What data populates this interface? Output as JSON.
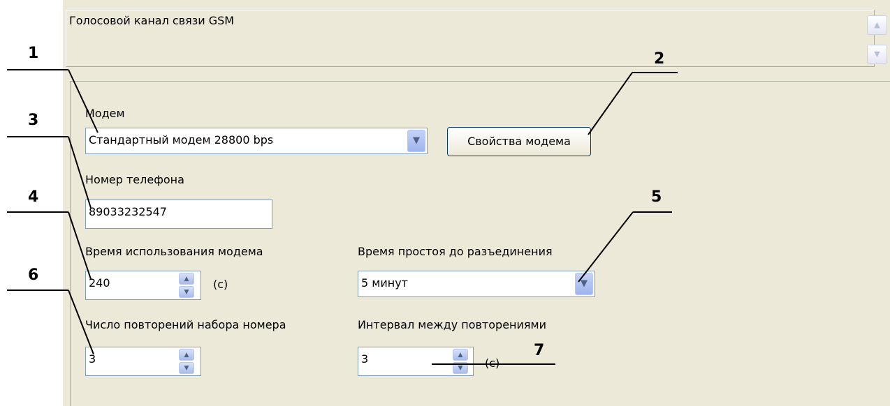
{
  "description": {
    "text": "Голосовой канал связи GSM",
    "scroll_up_icon": "arrow-up-icon",
    "scroll_down_icon": "arrow-down-icon"
  },
  "modem": {
    "label": "Модем",
    "selected": "Стандартный модем 28800 bps",
    "properties_button": "Свойства модема"
  },
  "phone": {
    "label": "Номер телефона",
    "value": "89033232547"
  },
  "usage_time": {
    "label": "Время использования модема",
    "value": "240",
    "unit": "(с)"
  },
  "idle_time": {
    "label": "Время простоя до разъединения",
    "selected": "5 минут"
  },
  "redial_count": {
    "label": "Число повторений набора номера",
    "value": "3"
  },
  "redial_interval": {
    "label": "Интервал между повторениями",
    "value": "3",
    "unit": "(с)"
  },
  "callouts": [
    "1",
    "2",
    "3",
    "4",
    "5",
    "6",
    "7"
  ],
  "colors": {
    "panel": "#ece9d8",
    "field_border": "#7f9db9",
    "button_border": "#003c74"
  }
}
